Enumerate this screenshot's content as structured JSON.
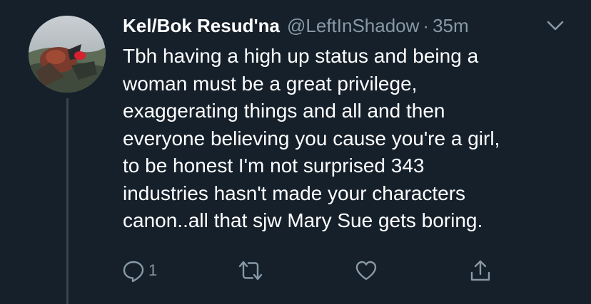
{
  "tweet": {
    "display_name": "Kel/Bok Resud'na",
    "handle": "@LeftInShadow",
    "separator": "·",
    "time": "35m",
    "text": "Tbh having a high up status and being a\nwoman must be a great privilege,\nexaggerating things and all and then\neveryone believing you cause you're a girl,\nto be honest I'm not surprised 343\nindustries hasn't made your characters\ncanon..all that sjw Mary Sue gets boring.",
    "reply_count": "1"
  },
  "icons": {
    "reply": "reply-icon",
    "retweet": "retweet-icon",
    "like": "heart-icon",
    "share": "share-icon",
    "more": "chevron-down-icon"
  },
  "colors": {
    "background": "#15202b",
    "text_primary": "#ffffff",
    "text_secondary": "#8899a6",
    "thread_line": "#38444d"
  }
}
